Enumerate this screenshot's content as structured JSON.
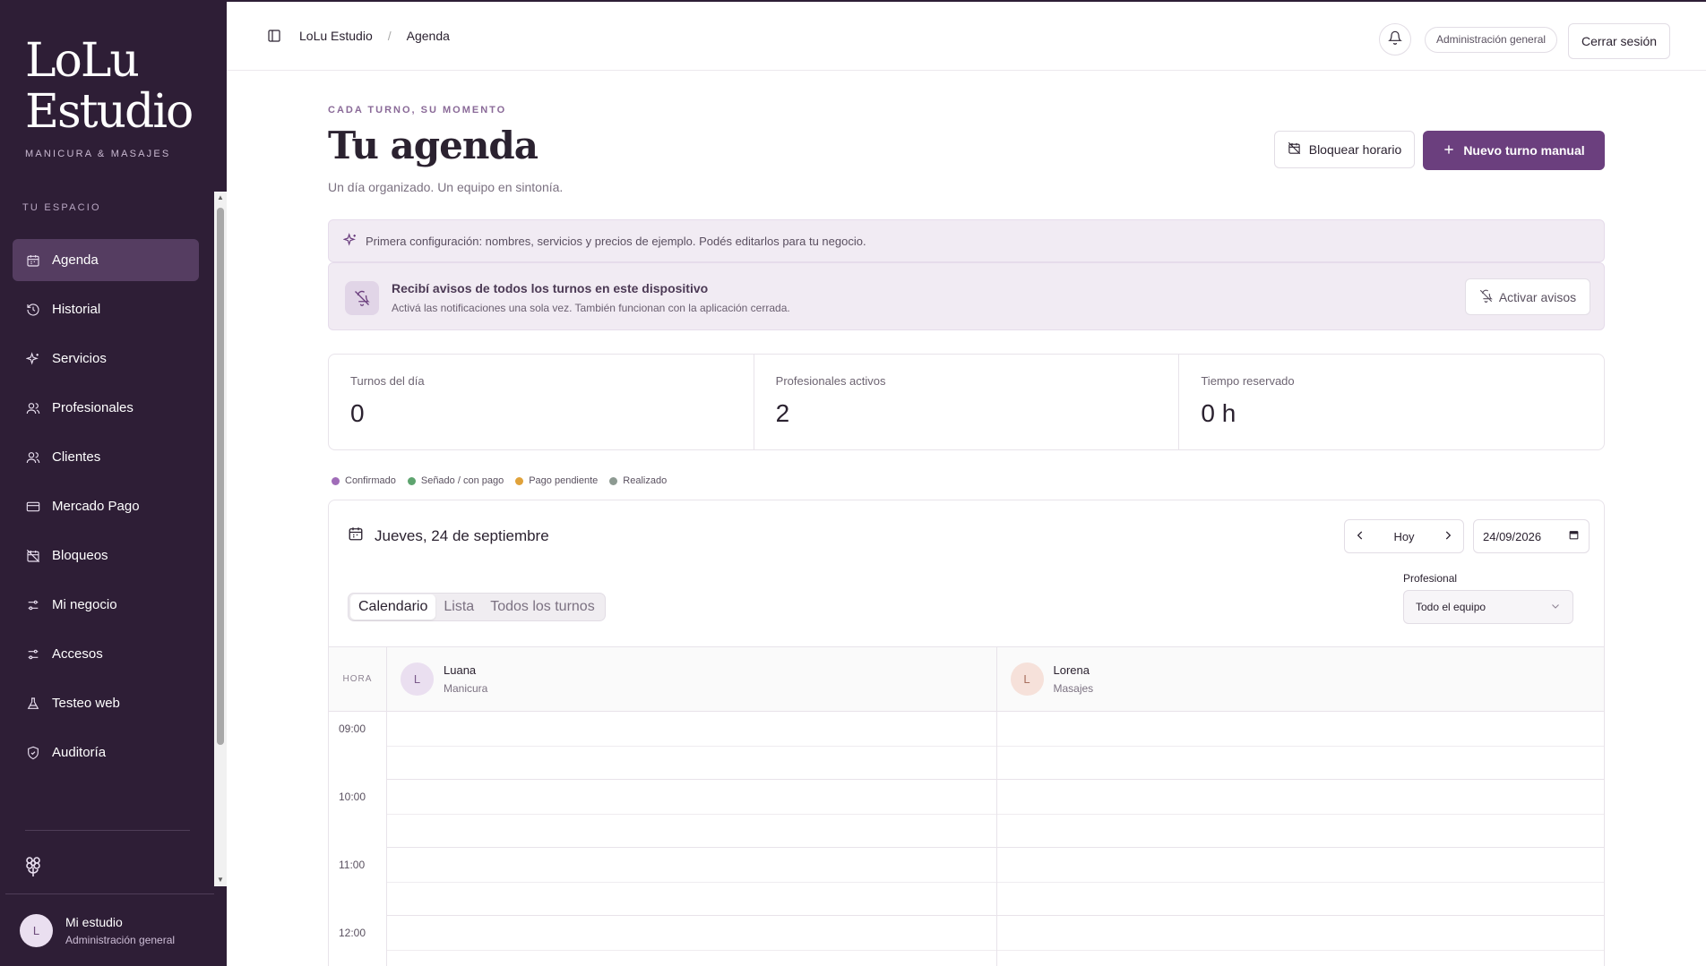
{
  "sidebar": {
    "logo_line1": "LoLu",
    "logo_line2": "Estudio",
    "tagline": "MANICURA & MASAJES",
    "section_label": "TU ESPACIO",
    "items": [
      {
        "label": "Agenda",
        "icon": "calendar-icon",
        "active": true
      },
      {
        "label": "Historial",
        "icon": "history-icon"
      },
      {
        "label": "Servicios",
        "icon": "sparkles-icon"
      },
      {
        "label": "Profesionales",
        "icon": "users-icon"
      },
      {
        "label": "Clientes",
        "icon": "users-icon"
      },
      {
        "label": "Mercado Pago",
        "icon": "credit-card-icon"
      },
      {
        "label": "Bloqueos",
        "icon": "calendar-off-icon"
      },
      {
        "label": "Mi negocio",
        "icon": "sliders-icon"
      },
      {
        "label": "Accesos",
        "icon": "sliders-icon"
      },
      {
        "label": "Testeo web",
        "icon": "flask-icon"
      },
      {
        "label": "Auditoría",
        "icon": "shield-check-icon"
      }
    ],
    "user": {
      "initial": "L",
      "name": "Mi estudio",
      "role": "Administración general"
    }
  },
  "topbar": {
    "breadcrumb_root": "LoLu Estudio",
    "breadcrumb_sep": "/",
    "breadcrumb_current": "Agenda",
    "role_pill": "Administración general",
    "logout_label": "Cerrar sesión"
  },
  "header": {
    "eyebrow": "CADA TURNO, SU MOMENTO",
    "title": "Tu agenda",
    "subtitle": "Un día organizado. Un equipo en sintonía.",
    "block_button": "Bloquear horario",
    "new_button": "Nuevo turno manual"
  },
  "banners": {
    "setup_text": "Primera configuración: nombres, servicios y precios de ejemplo. Podés editarlos para tu negocio.",
    "notify_title": "Recibí avisos de todos los turnos en este dispositivo",
    "notify_desc": "Activá las notificaciones una sola vez. También funcionan con la aplicación cerrada.",
    "notify_button": "Activar avisos"
  },
  "stats": [
    {
      "label": "Turnos del día",
      "value": "0"
    },
    {
      "label": "Profesionales activos",
      "value": "2"
    },
    {
      "label": "Tiempo reservado",
      "value": "0 h"
    }
  ],
  "legend": [
    {
      "label": "Confirmado",
      "color": "#a06cb8"
    },
    {
      "label": "Señado / con pago",
      "color": "#5ea46f"
    },
    {
      "label": "Pago pendiente",
      "color": "#e0a23a"
    },
    {
      "label": "Realizado",
      "color": "#8d9a92"
    }
  ],
  "calendar": {
    "date_label": "Jueves, 24 de septiembre",
    "today_label": "Hoy",
    "date_value": "24/09/2026",
    "tabs": [
      "Calendario",
      "Lista",
      "Todos los turnos"
    ],
    "active_tab": "Calendario",
    "professional_label": "Profesional",
    "professional_value": "Todo el equipo",
    "hour_header": "HORA",
    "professionals": [
      {
        "initial": "L",
        "name": "Luana",
        "specialty": "Manicura",
        "color": "#eadff0",
        "text_color": "#7a5a8a"
      },
      {
        "initial": "L",
        "name": "Lorena",
        "specialty": "Masajes",
        "color": "#f6e1da",
        "text_color": "#a86f5e"
      }
    ],
    "hours": [
      "09:00",
      "10:00",
      "11:00",
      "12:00"
    ]
  }
}
